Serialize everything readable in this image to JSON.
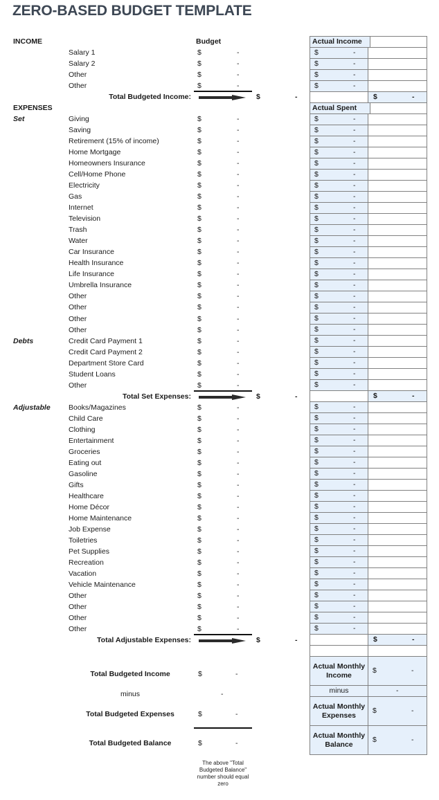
{
  "title": "ZERO-BASED BUDGET TEMPLATE",
  "income": {
    "section_label": "INCOME",
    "budget_header": "Budget",
    "items": [
      "Salary 1",
      "Salary 2",
      "Other",
      "Other"
    ],
    "total_label": "Total Budgeted Income:"
  },
  "expenses": {
    "section_label": "EXPENSES",
    "set": {
      "label": "Set",
      "items": [
        "Giving",
        "Saving",
        "Retirement (15% of income)",
        "Home Mortgage",
        "Homeowners Insurance",
        "Cell/Home Phone",
        "Electricity",
        "Gas",
        "Internet",
        "Television",
        "Trash",
        "Water",
        "Car Insurance",
        "Health Insurance",
        "Life Insurance",
        "Umbrella Insurance",
        "Other",
        "Other",
        "Other",
        "Other"
      ]
    },
    "debts": {
      "label": "Debts",
      "items": [
        "Credit Card Payment 1",
        "Credit Card Payment 2",
        "Department Store Card",
        "Student Loans",
        "Other"
      ]
    },
    "set_total_label": "Total Set Expenses:",
    "adjustable": {
      "label": "Adjustable",
      "items": [
        "Books/Magazines",
        "Child Care",
        "Clothing",
        "Entertainment",
        "Groceries",
        "Eating out",
        "Gasoline",
        "Gifts",
        "Healthcare",
        "Home Décor",
        "Home Maintenance",
        "Job Expense",
        "Toiletries",
        "Pet Supplies",
        "Recreation",
        "Vacation",
        "Vehicle Maintenance",
        "Other",
        "Other",
        "Other",
        "Other"
      ]
    },
    "adjustable_total_label": "Total Adjustable Expenses:"
  },
  "currency_symbol": "$",
  "empty_value": "-",
  "actual": {
    "income_header": "Actual Income",
    "spent_header": "Actual Spent"
  },
  "summary": {
    "budgeted_income_label": "Total Budgeted Income",
    "minus_label": "minus",
    "budgeted_expenses_label": "Total Budgeted Expenses",
    "budgeted_balance_label": "Total Budgeted Balance",
    "note": "The above \"Total Budgeted Balance\" number should equal zero",
    "actual_income_label": "Actual Monthly Income",
    "actual_expenses_label": "Actual Monthly Expenses",
    "actual_balance_label": "Actual Monthly Balance"
  },
  "colors": {
    "title": "#3d4754",
    "cell_highlight": "#e6f0fb",
    "grid_border": "#808080"
  }
}
